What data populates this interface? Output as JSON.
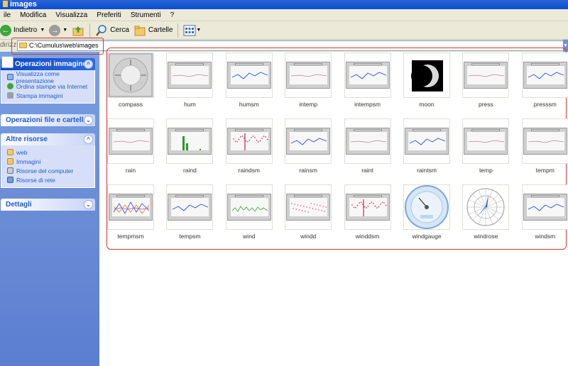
{
  "window": {
    "title": "images"
  },
  "menu": [
    "ile",
    "Modifica",
    "Visualizza",
    "Preferiti",
    "Strumenti",
    "?"
  ],
  "toolbar": {
    "back_label": "Indietro",
    "search_label": "Cerca",
    "folders_label": "Cartelle"
  },
  "address": {
    "label": "dirizzo",
    "value": "C:\\Cumulus\\web\\images"
  },
  "left_pane": {
    "image_tasks": {
      "title": "Operazioni immagine",
      "items": [
        "Visualizza come presentazione",
        "Ordina stampe via Internet",
        "Stampa immagini"
      ]
    },
    "file_tasks": {
      "title": "Operazioni file e cartella"
    },
    "other_places": {
      "title": "Altre risorse",
      "items": [
        "web",
        "Immagini",
        "Risorse del computer",
        "Risorse di rete"
      ]
    },
    "details": {
      "title": "Dettagli"
    }
  },
  "files": [
    {
      "name": "compass",
      "kind": "compass"
    },
    {
      "name": "hum",
      "kind": "chart"
    },
    {
      "name": "humsm",
      "kind": "chart-small"
    },
    {
      "name": "intemp",
      "kind": "chart"
    },
    {
      "name": "intempsm",
      "kind": "chart-small"
    },
    {
      "name": "moon",
      "kind": "moon"
    },
    {
      "name": "press",
      "kind": "chart"
    },
    {
      "name": "presssm",
      "kind": "chart-small"
    },
    {
      "name": "rain",
      "kind": "chart"
    },
    {
      "name": "raind",
      "kind": "chart-bars"
    },
    {
      "name": "raindsm",
      "kind": "chart-small-red"
    },
    {
      "name": "rainsm",
      "kind": "chart-small"
    },
    {
      "name": "raint",
      "kind": "chart"
    },
    {
      "name": "raintsm",
      "kind": "chart-small"
    },
    {
      "name": "temp",
      "kind": "chart"
    },
    {
      "name": "tempm",
      "kind": "chart"
    },
    {
      "name": "tempmsm",
      "kind": "chart-small-multi"
    },
    {
      "name": "tempsm",
      "kind": "chart-small"
    },
    {
      "name": "wind",
      "kind": "chart-green"
    },
    {
      "name": "windd",
      "kind": "chart-dots"
    },
    {
      "name": "winddsm",
      "kind": "chart-small-red"
    },
    {
      "name": "windgauge",
      "kind": "gauge"
    },
    {
      "name": "windrose",
      "kind": "rose"
    },
    {
      "name": "windsm",
      "kind": "chart-small"
    }
  ],
  "colors": {
    "title_bar": "#0a4fd0",
    "task_pane": "#6e8fd6",
    "link": "#215dc6",
    "annotation": "#dd3333"
  }
}
